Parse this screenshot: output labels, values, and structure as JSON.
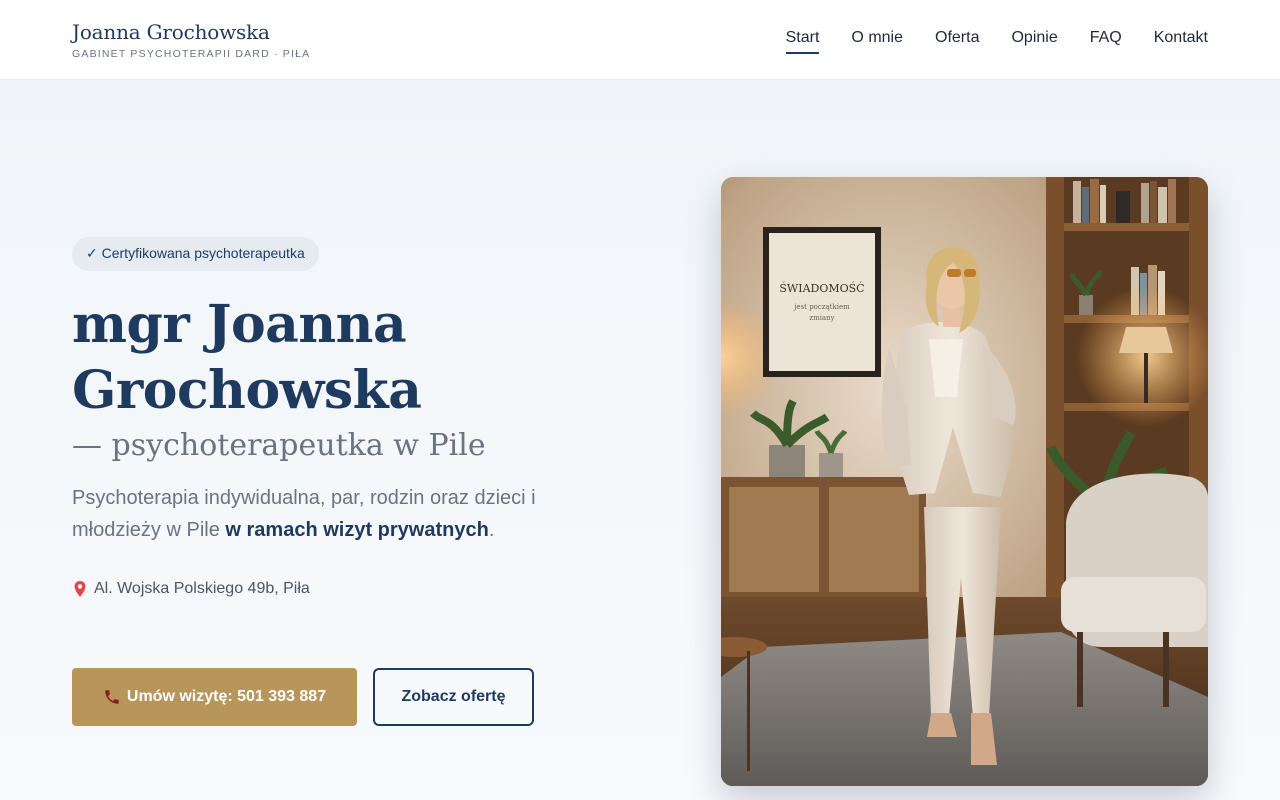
{
  "header": {
    "brand_name": "Joanna Grochowska",
    "brand_sub": "GABINET PSYCHOTERAPII DARD · PIŁA",
    "nav": [
      {
        "label": "Start",
        "active": true
      },
      {
        "label": "O mnie"
      },
      {
        "label": "Oferta"
      },
      {
        "label": "Opinie"
      },
      {
        "label": "FAQ"
      },
      {
        "label": "Kontakt"
      }
    ]
  },
  "hero": {
    "badge": "✓ Certyfikowana psychoterapeutka",
    "title_line1": "mgr Joanna",
    "title_line2": "Grochowska",
    "subtitle": "— psychoterapeutka w Pile",
    "desc_text": "Psychoterapia indywidualna, par, rodzin oraz dzieci i młodzieży w Pile ",
    "desc_strong": "w ramach wizyt prywatnych",
    "desc_end": ".",
    "address": "Al. Wojska Polskiego 49b, Piła",
    "cta_primary": "Umów wizytę: 501 393 887",
    "cta_secondary": "Zobacz ofertę"
  },
  "photo": {
    "poster_title": "ŚWIADOMOŚĆ",
    "poster_line1": "jest początkiem",
    "poster_line2": "zmiany"
  },
  "colors": {
    "primary": "#1f3a5f",
    "accent": "#b8955a",
    "background": "#f2f5f8"
  },
  "icons": {
    "badge": "check-icon",
    "address": "map-pin-icon",
    "cta_primary": "phone-icon"
  }
}
